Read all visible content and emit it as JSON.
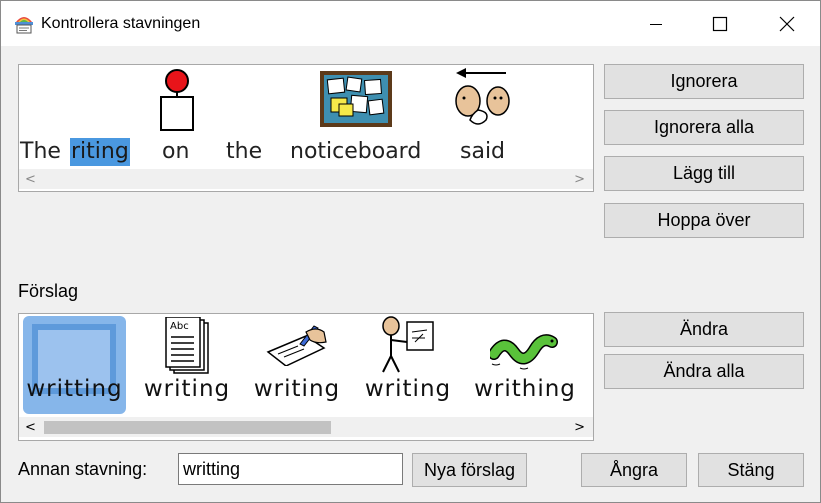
{
  "window": {
    "title": "Kontrollera stavningen",
    "controls": {
      "minimize": "minimize",
      "maximize": "maximize",
      "close": "close"
    }
  },
  "sentence": {
    "words": [
      "The",
      "riting",
      "on",
      "the",
      "noticeboard",
      "said"
    ],
    "highlighted_word": "riting"
  },
  "right_buttons": {
    "ignore": "Ignorera",
    "ignore_all": "Ignorera alla",
    "add": "Lägg till",
    "skip": "Hoppa över",
    "change": "Ändra",
    "change_all": "Ändra alla"
  },
  "suggestions": {
    "label": "Förslag",
    "items": [
      "writting",
      "writing",
      "writing",
      "writing",
      "writhing"
    ],
    "selected_index": 0
  },
  "bottom": {
    "other_spelling_label": "Annan stavning:",
    "other_spelling_value": "writting",
    "new_suggestions": "Nya förslag",
    "undo": "Ångra",
    "close": "Stäng"
  },
  "colors": {
    "highlight": "#4a98e0",
    "selection": "#86b6ea",
    "button_bg": "#e1e1e1"
  }
}
